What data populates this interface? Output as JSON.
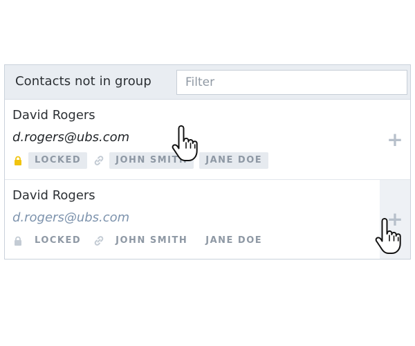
{
  "header": {
    "title": "Contacts not in group",
    "filter_placeholder": "Filter"
  },
  "contacts": [
    {
      "name": "David Rogers",
      "email": "d.rogers@ubs.com",
      "locked_label": "LOCKED",
      "links": [
        "JOHN SMITH",
        "JANE DOE"
      ],
      "add_label": "+",
      "state": "normal"
    },
    {
      "name": "David Rogers",
      "email": "d.rogers@ubs.com",
      "locked_label": "LOCKED",
      "links": [
        "JOHN SMITH",
        "JANE DOE"
      ],
      "add_label": "+",
      "state": "hover-add"
    }
  ],
  "icons": {
    "lock_active_color": "#f1c40f",
    "lock_inactive_color": "#c3cbd4",
    "link_color": "#c3cbd4",
    "cursor": "hand-pointer-icon"
  }
}
